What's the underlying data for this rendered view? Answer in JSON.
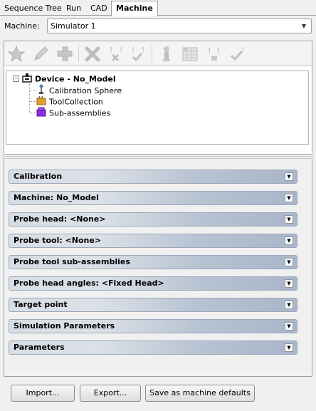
{
  "tabs": [
    {
      "label": "Sequence Tree"
    },
    {
      "label": "Run"
    },
    {
      "label": "CAD"
    },
    {
      "label": "Machine"
    }
  ],
  "machine": {
    "label": "Machine:",
    "selected": "Simulator 1"
  },
  "toolbar": {
    "icons": [
      "star-icon",
      "pencil-icon",
      "plus-icon",
      "delete-x-icon",
      "x-mark-icon",
      "check-mark-icon",
      "probe-icon",
      "grid-table-icon",
      "exclaim-marks-icon",
      "check-exclaim-icon"
    ]
  },
  "tree": {
    "root": "Device - No_Model",
    "children": [
      {
        "label": "Calibration Sphere",
        "icon": "calibration-sphere-icon"
      },
      {
        "label": "ToolCollection",
        "icon": "tool-collection-icon"
      },
      {
        "label": "Sub-assemblies",
        "icon": "sub-assemblies-icon"
      }
    ]
  },
  "sections": [
    {
      "label": "Calibration"
    },
    {
      "label": "Machine: No_Model"
    },
    {
      "label": "Probe head: <None>"
    },
    {
      "label": "Probe tool: <None>"
    },
    {
      "label": "Probe tool sub-assemblies"
    },
    {
      "label": "Probe head angles: <Fixed Head>"
    },
    {
      "label": "Target point"
    },
    {
      "label": "Simulation Parameters"
    },
    {
      "label": "Parameters"
    }
  ],
  "buttons": {
    "import": "Import...",
    "export": "Export...",
    "save_defaults": "Save as machine defaults"
  },
  "colors": {
    "accordion_left": "#d7dde4",
    "accordion_right": "#a9b6c8",
    "device_icon": "#1a1a1a",
    "sub_assemblies_icon": "#8a2be2",
    "tool_collection_icon": "#e0a030"
  }
}
